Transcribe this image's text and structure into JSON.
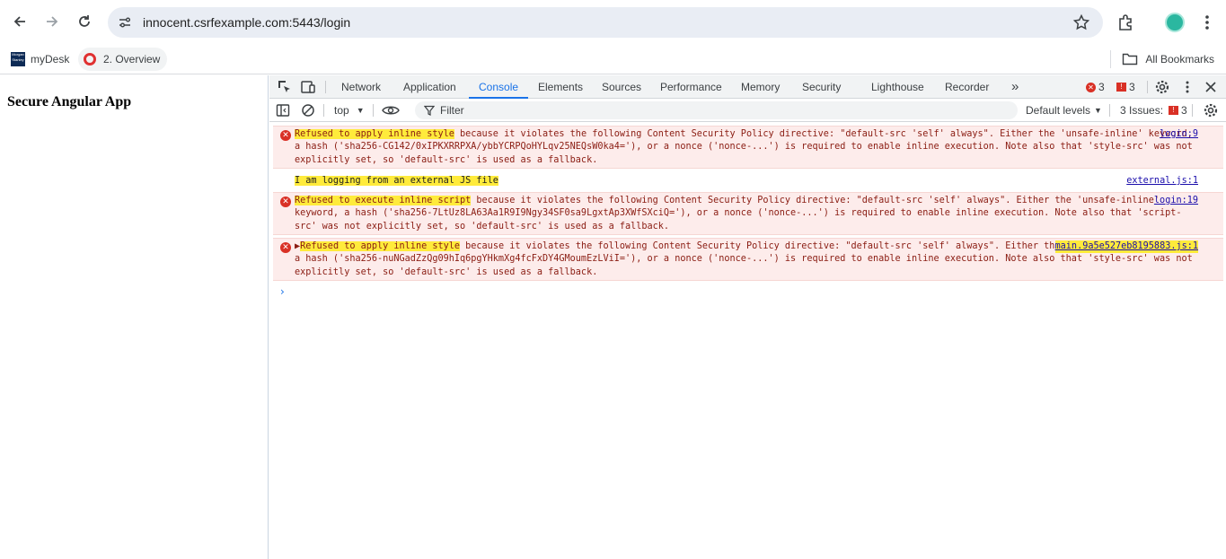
{
  "browser": {
    "url": "innocent.csrfexample.com:5443/login"
  },
  "bookmarks": {
    "items": [
      {
        "label": "myDesk",
        "logo_text": "Morgan Stanley"
      },
      {
        "label": "2. Overview"
      }
    ],
    "all_label": "All Bookmarks"
  },
  "page": {
    "title": "Secure Angular App"
  },
  "devtools": {
    "tabs": [
      "Network",
      "Application",
      "Console",
      "Elements",
      "Sources",
      "Performance",
      "Memory",
      "Security",
      "Lighthouse",
      "Recorder"
    ],
    "active_tab": "Console",
    "more_tabs": "»",
    "error_count": "3",
    "warning_count": "3",
    "filterbar": {
      "context": "top",
      "filter_placeholder": "Filter",
      "levels": "Default levels",
      "issues_label": "3 Issues:",
      "issues_count": "3"
    },
    "messages": [
      {
        "type": "error",
        "highlight": "Refused to apply inline style",
        "text": " because it violates the following Content Security Policy directive: \"default-src 'self' always\". Either the 'unsafe-inline' keyword, a hash ('sha256-CG142/0xIPKXRRPXA/ybbYCRPQoHYLqv25NEQsW0ka4='), or a nonce ('nonce-...') is required to enable inline execution. Note also that 'style-src' was not explicitly set, so 'default-src' is used as a fallback.",
        "source": "login:9"
      },
      {
        "type": "log",
        "highlight": "I am logging from an external JS file",
        "text": "",
        "source": "external.js:1"
      },
      {
        "type": "error",
        "highlight": "Refused to execute inline script",
        "text": " because it violates the following Content Security Policy directive: \"default-src 'self' always\". Either the 'unsafe-inline' keyword, a hash ('sha256-7LtUz8LA63Aa1R9I9Ngy34SF0sa9LgxtAp3XWfSXciQ='), or a nonce ('nonce-...') is required to enable inline execution. Note also that 'script-src' was not explicitly set, so 'default-src' is used as a fallback.",
        "source": "login:19"
      },
      {
        "type": "error",
        "expand": "▶",
        "highlight": "Refused to apply inline style",
        "text": " because it violates the following Content Security Policy directive: \"default-src 'self' always\". Either the 'unsafe-inline' keyword, a hash ('sha256-nuNGadZzQg09hIq6pgYHkmXg4fcFxDY4GMoumEzLViI='), or a nonce ('nonce-...') is required to enable inline execution. Note also that 'style-src' was not explicitly set, so 'default-src' is used as a fallback.",
        "source": "main.9a5e527eb8195883.js:1"
      }
    ],
    "prompt": "›"
  },
  "colors": {
    "accent": "#1a73e8",
    "error": "#d93025",
    "error_bg": "#fdeceb",
    "highlight": "#ffeb3b"
  }
}
